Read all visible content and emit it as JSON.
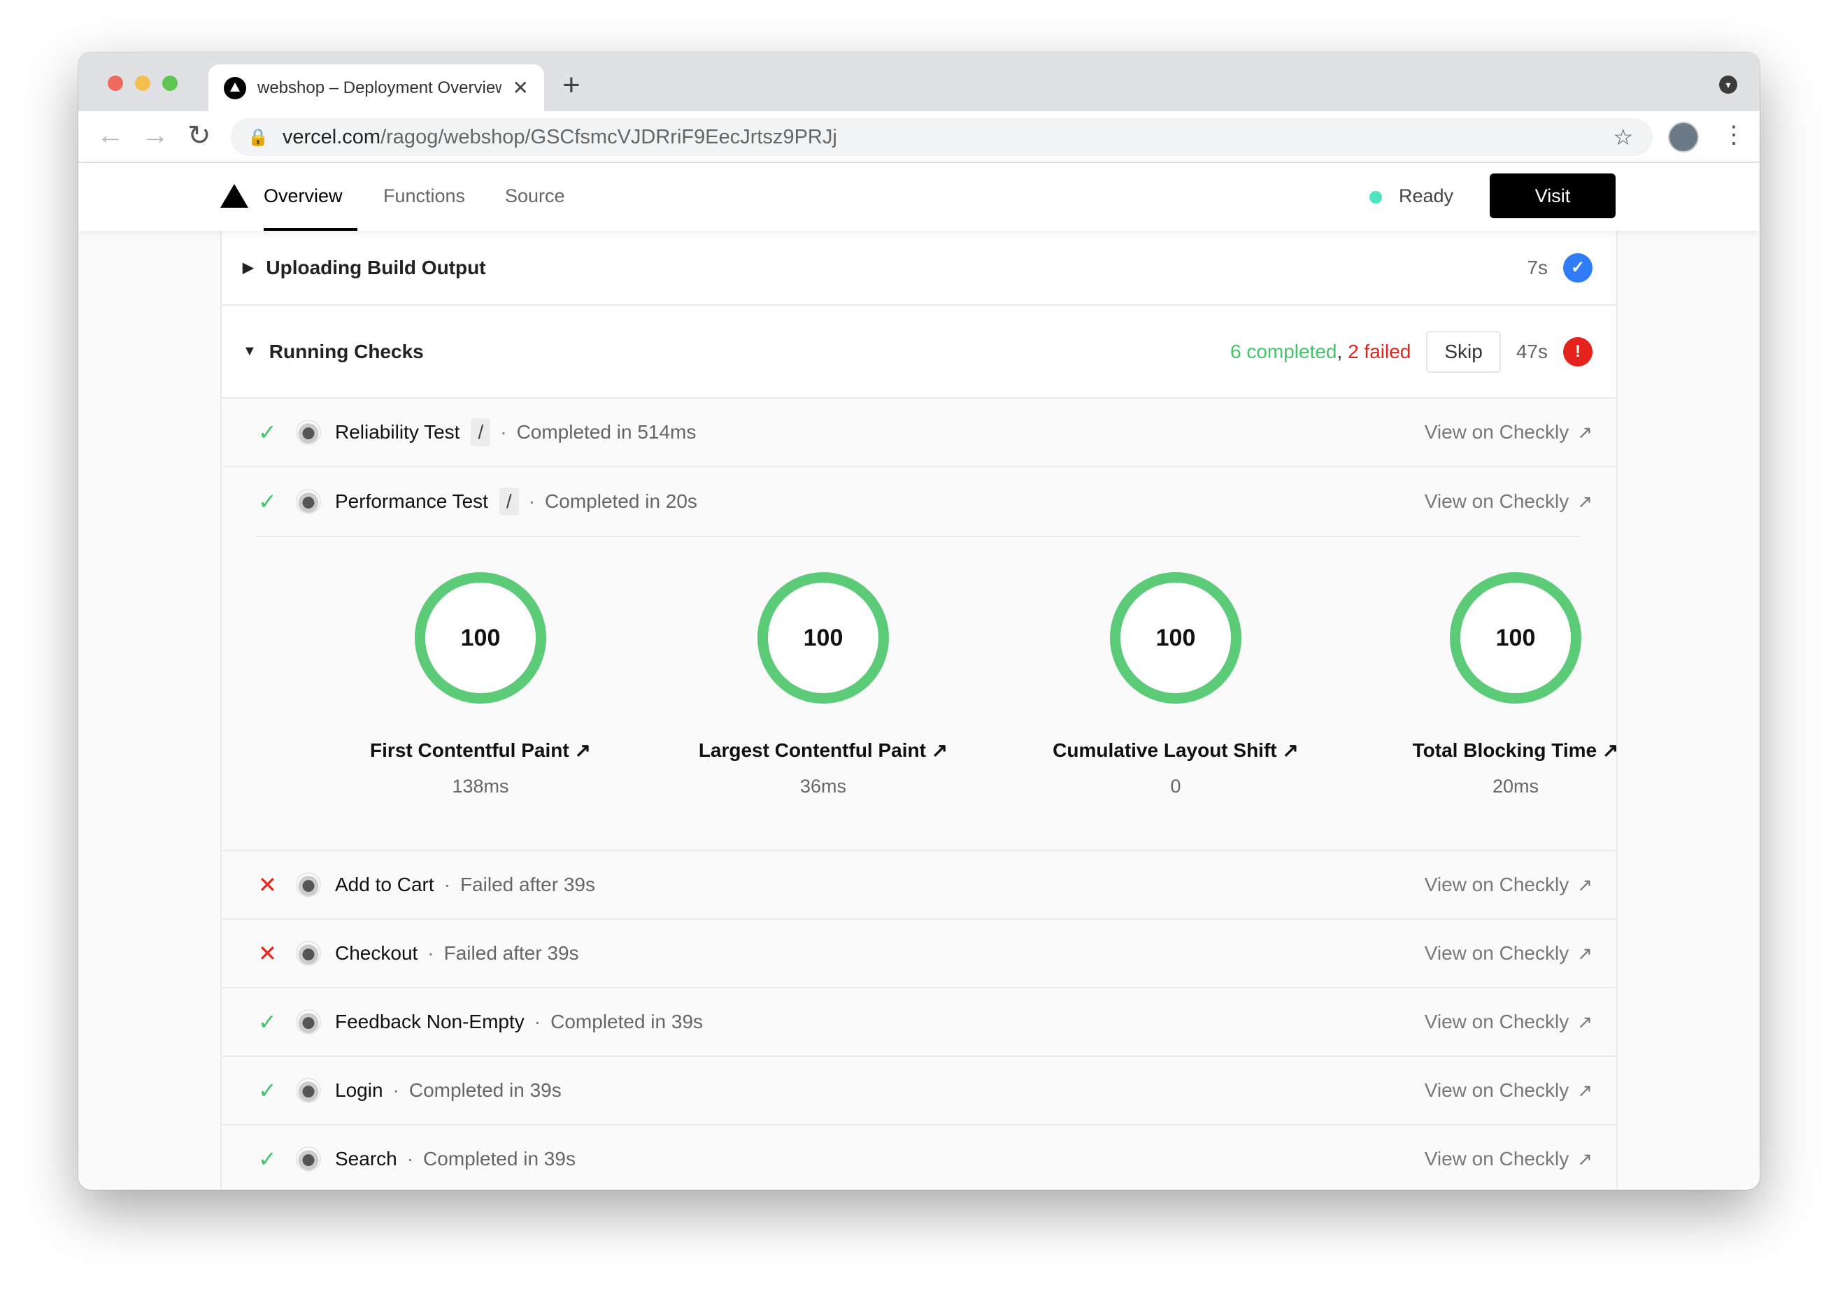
{
  "browser": {
    "tab_title": "webshop – Deployment Overview",
    "url_host": "vercel.com",
    "url_path": "/ragog/webshop/GSCfsmcVJDRriF9EecJrtsz9PRJj"
  },
  "header": {
    "tabs": [
      "Overview",
      "Functions",
      "Source"
    ],
    "status": "Ready",
    "visit_label": "Visit",
    "status_color": "#50e3c2"
  },
  "uploading": {
    "title": "Uploading Build Output",
    "duration": "7s"
  },
  "running": {
    "title": "Running Checks",
    "completed": "6 completed",
    "failed": "2 failed",
    "skip_label": "Skip",
    "duration": "47s"
  },
  "link_label": "View on Checkly",
  "checks": [
    {
      "status": "passed",
      "name": "Reliability Test",
      "tag": "/",
      "desc": "Completed in 514ms"
    },
    {
      "status": "passed",
      "name": "Performance Test",
      "tag": "/",
      "desc": "Completed in 20s"
    },
    {
      "status": "failed",
      "name": "Add to Cart",
      "desc": "Failed after 39s"
    },
    {
      "status": "failed",
      "name": "Checkout",
      "desc": "Failed after 39s"
    },
    {
      "status": "passed",
      "name": "Feedback Non-Empty",
      "desc": "Completed in 39s"
    },
    {
      "status": "passed",
      "name": "Login",
      "desc": "Completed in 39s"
    },
    {
      "status": "passed",
      "name": "Search",
      "desc": "Completed in 39s"
    }
  ],
  "metrics": [
    {
      "score": "100",
      "label": "First Contentful Paint",
      "value": "138ms"
    },
    {
      "score": "100",
      "label": "Largest Contentful Paint",
      "value": "36ms"
    },
    {
      "score": "100",
      "label": "Cumulative Layout Shift",
      "value": "0"
    },
    {
      "score": "100",
      "label": "Total Blocking Time",
      "value": "20ms"
    }
  ]
}
